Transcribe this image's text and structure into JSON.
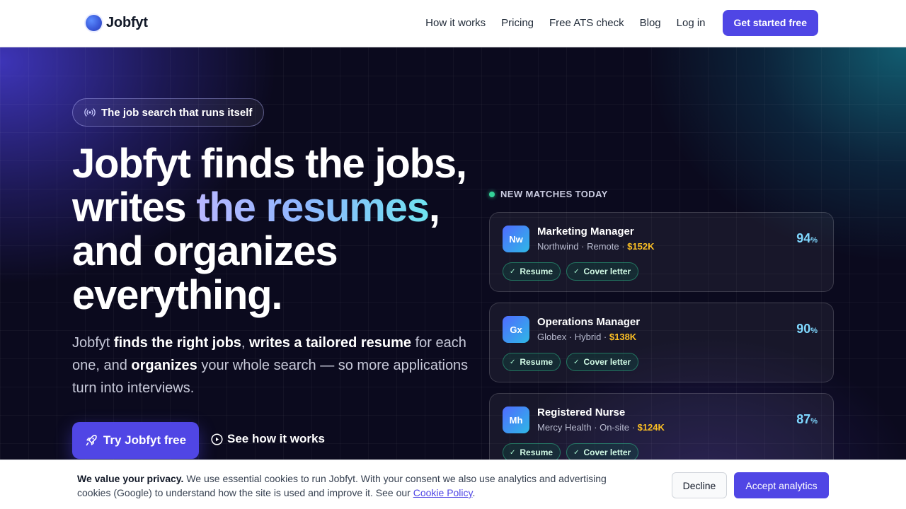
{
  "brand": {
    "name": "Jobfyt"
  },
  "nav": {
    "items": [
      "How it works",
      "Pricing",
      "Free ATS check",
      "Blog",
      "Log in"
    ],
    "cta": "Get started free"
  },
  "hero": {
    "pill": "The job search that runs itself",
    "headline": {
      "line1": "Jobfyt finds the jobs,",
      "line2_pre": "writes ",
      "line2_grad": "the resumes",
      "line2_post": ",",
      "line3": "and organizes",
      "line4": "everything."
    },
    "sub": {
      "p1": "Jobfyt ",
      "b1": "finds the right jobs",
      "p2": ", ",
      "b2": "writes a tailored resume",
      "p3": " for each one, and ",
      "b3": "organizes",
      "p4": " your whole search — so more applications turn into interviews."
    },
    "primary_button": "Try Jobfyt free",
    "secondary_button": "See how it works"
  },
  "matches": {
    "label": "NEW MATCHES TODAY",
    "cards": [
      {
        "initials": "Nw",
        "title": "Marketing Manager",
        "meta": "Northwind · Remote · ",
        "salary": "$152K",
        "score": "94",
        "unit": "%",
        "tags": [
          "Resume",
          "Cover letter"
        ]
      },
      {
        "initials": "Gx",
        "title": "Operations Manager",
        "meta": "Globex · Hybrid · ",
        "salary": "$138K",
        "score": "90",
        "unit": "%",
        "tags": [
          "Resume",
          "Cover letter"
        ]
      },
      {
        "initials": "Mh",
        "title": "Registered Nurse",
        "meta": "Mercy Health · On-site · ",
        "salary": "$124K",
        "score": "87",
        "unit": "%",
        "tags": [
          "Resume",
          "Cover letter"
        ]
      }
    ]
  },
  "cookie": {
    "title": "We value your privacy.",
    "text": " We use essential cookies to run Jobfyt. With your consent we also use analytics and advertising cookies (Google) to understand how the site is used and improve it. See our ",
    "link": "Cookie Policy",
    "end": ".",
    "decline": "Decline",
    "accept": "Accept analytics"
  },
  "colors": {
    "accent": "#5046e5",
    "salary": "#fbbf24",
    "score": "#7fd8ff",
    "live": "#34d399"
  }
}
